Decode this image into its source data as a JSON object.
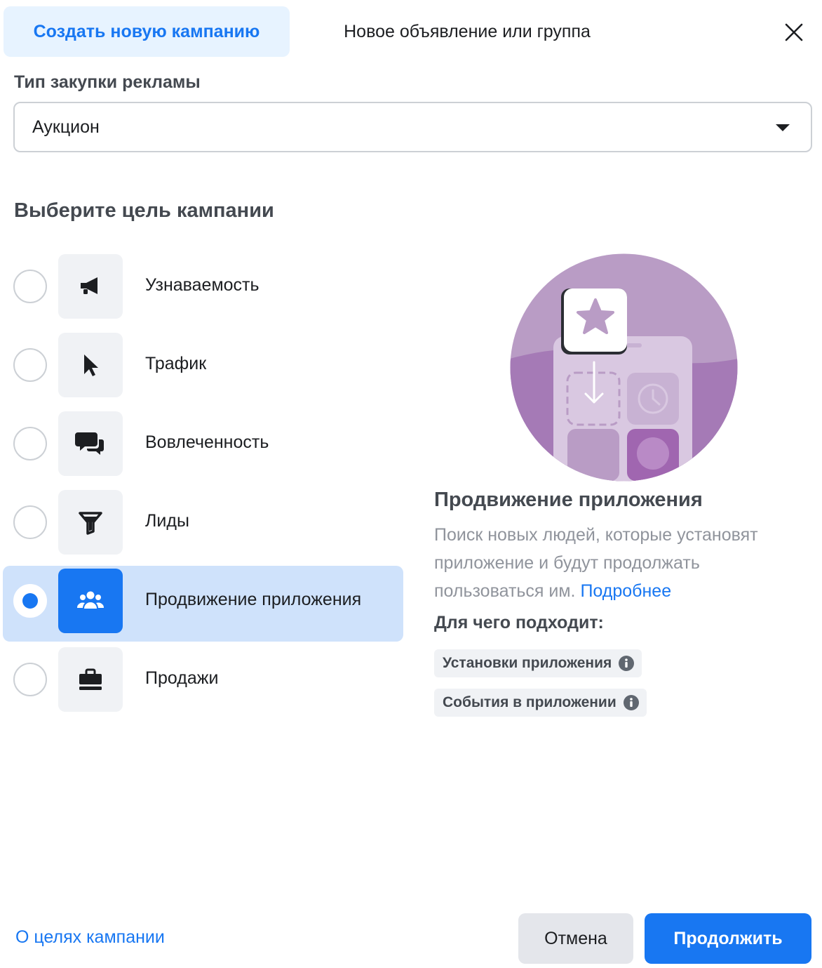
{
  "tabs": {
    "create_campaign": "Создать новую кампанию",
    "new_ad_or_group": "Новое объявление или группа"
  },
  "close": {
    "icon": "close-icon"
  },
  "buy_type": {
    "label": "Тип закупки рекламы",
    "selected": "Аукцион"
  },
  "objective": {
    "heading": "Выберите цель кампании",
    "items": [
      {
        "label": "Узнаваемость",
        "icon": "megaphone-icon",
        "selected": false
      },
      {
        "label": "Трафик",
        "icon": "cursor-icon",
        "selected": false
      },
      {
        "label": "Вовлеченность",
        "icon": "chat-bubbles-icon",
        "selected": false
      },
      {
        "label": "Лиды",
        "icon": "funnel-icon",
        "selected": false
      },
      {
        "label": "Продвижение приложения",
        "icon": "people-group-icon",
        "selected": true
      },
      {
        "label": "Продажи",
        "icon": "shopping-bag-icon",
        "selected": false
      }
    ]
  },
  "detail": {
    "title": "Продвижение приложения",
    "description": "Поиск новых людей, которые установят приложение и будут продолжать пользоваться им.",
    "more_link": "Подробнее",
    "suits_heading": "Для чего подходит:",
    "chips": [
      {
        "label": "Установки приложения",
        "icon": "info-icon"
      },
      {
        "label": "События в приложении",
        "icon": "info-icon"
      }
    ]
  },
  "footer": {
    "about_link": "О целях кампании",
    "cancel": "Отмена",
    "continue": "Продолжить"
  },
  "colors": {
    "accent": "#1877f2",
    "selected_row": "#cfe2fb",
    "tab_active_bg": "#e7f3ff",
    "illustration_purple": "#b99cc5"
  }
}
